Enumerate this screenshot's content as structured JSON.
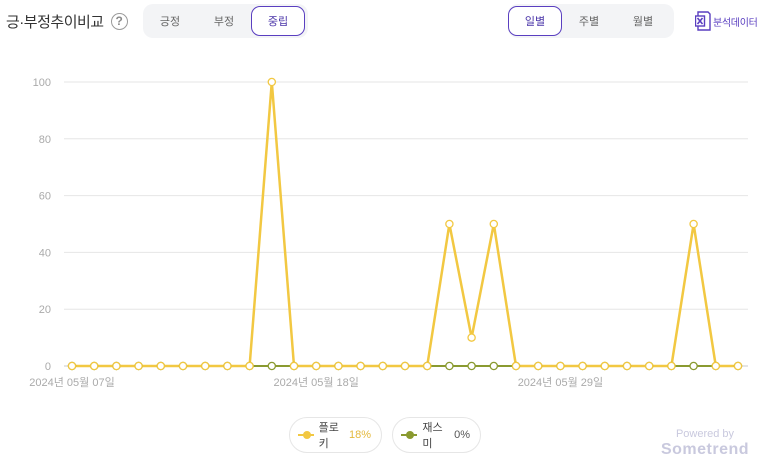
{
  "header": {
    "title": "긍·부정추이비교",
    "help_symbol": "?"
  },
  "sentiment_tabs": [
    {
      "label": "긍정",
      "active": false
    },
    {
      "label": "부정",
      "active": false
    },
    {
      "label": "중립",
      "active": true
    }
  ],
  "period_tabs": [
    {
      "label": "일별",
      "active": true
    },
    {
      "label": "주별",
      "active": false
    },
    {
      "label": "월별",
      "active": false
    }
  ],
  "analysis_button": {
    "label": "분석데이터",
    "icon": "excel-icon"
  },
  "chart_data": {
    "type": "line",
    "ylim": [
      0,
      100
    ],
    "yticks": [
      0,
      20,
      40,
      60,
      80,
      100
    ],
    "grid": true,
    "x": [
      "2024-05-07",
      "2024-05-08",
      "2024-05-09",
      "2024-05-10",
      "2024-05-11",
      "2024-05-12",
      "2024-05-13",
      "2024-05-14",
      "2024-05-15",
      "2024-05-16",
      "2024-05-17",
      "2024-05-18",
      "2024-05-19",
      "2024-05-20",
      "2024-05-21",
      "2024-05-22",
      "2024-05-23",
      "2024-05-24",
      "2024-05-25",
      "2024-05-26",
      "2024-05-27",
      "2024-05-28",
      "2024-05-29",
      "2024-05-30",
      "2024-05-31",
      "2024-06-01",
      "2024-06-02",
      "2024-06-03",
      "2024-06-04",
      "2024-06-05",
      "2024-06-06",
      "2024-06-07",
      "2024-06-08",
      "2024-06-09",
      "2024-06-10",
      "2024-06-11",
      "2024-06-12",
      "2024-06-13",
      "2024-06-14",
      "2024-06-15",
      "2024-06-16",
      "2024-06-17",
      "2024-06-18",
      "2024-06-19"
    ],
    "x_tick_labels": [
      {
        "index": 0,
        "label": "2024년 05월 07일"
      },
      {
        "index": 11,
        "label": "2024년 05월 18일"
      },
      {
        "index": 22,
        "label": "2024년 05월 29일"
      }
    ],
    "series": [
      {
        "name": "플로키",
        "pct": "18%",
        "color": "#f2c842",
        "values": [
          0,
          0,
          0,
          0,
          0,
          0,
          0,
          0,
          0,
          100,
          0,
          0,
          0,
          0,
          0,
          0,
          0,
          50,
          10,
          50,
          0,
          0,
          0,
          0,
          0,
          0,
          0,
          0,
          50,
          0,
          0
        ]
      },
      {
        "name": "재스미",
        "pct": "0%",
        "color": "#8a9a30",
        "values": [
          0,
          0,
          0,
          0,
          0,
          0,
          0,
          0,
          0,
          0,
          0,
          0,
          0,
          0,
          0,
          0,
          0,
          0,
          0,
          0,
          0,
          0,
          0,
          0,
          0,
          0,
          0,
          0,
          0,
          0,
          0
        ]
      }
    ]
  },
  "branding": {
    "powered": "Powered by",
    "brand": "Sometrend"
  }
}
